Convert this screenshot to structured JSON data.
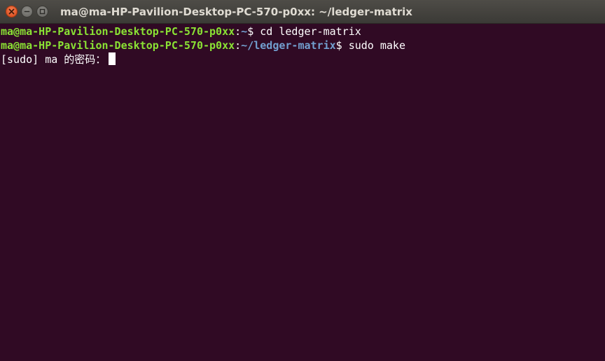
{
  "window": {
    "title": "ma@ma-HP-Pavilion-Desktop-PC-570-p0xx: ~/ledger-matrix"
  },
  "terminal": {
    "lines": [
      {
        "user_host": "ma@ma-HP-Pavilion-Desktop-PC-570-p0xx",
        "separator": ":",
        "path": "~",
        "command": "$ cd ledger-matrix"
      },
      {
        "user_host": "ma@ma-HP-Pavilion-Desktop-PC-570-p0xx",
        "separator": ":",
        "path": "~/ledger-matrix",
        "command": "$ sudo make"
      }
    ],
    "password_prompt": "[sudo] ma 的密码："
  },
  "colors": {
    "background": "#300a24",
    "prompt_user": "#8ae234",
    "prompt_path": "#729fcf",
    "close_button": "#e95420"
  },
  "icons": {
    "close": "close-icon",
    "minimize": "minimize-icon",
    "maximize": "maximize-icon"
  }
}
